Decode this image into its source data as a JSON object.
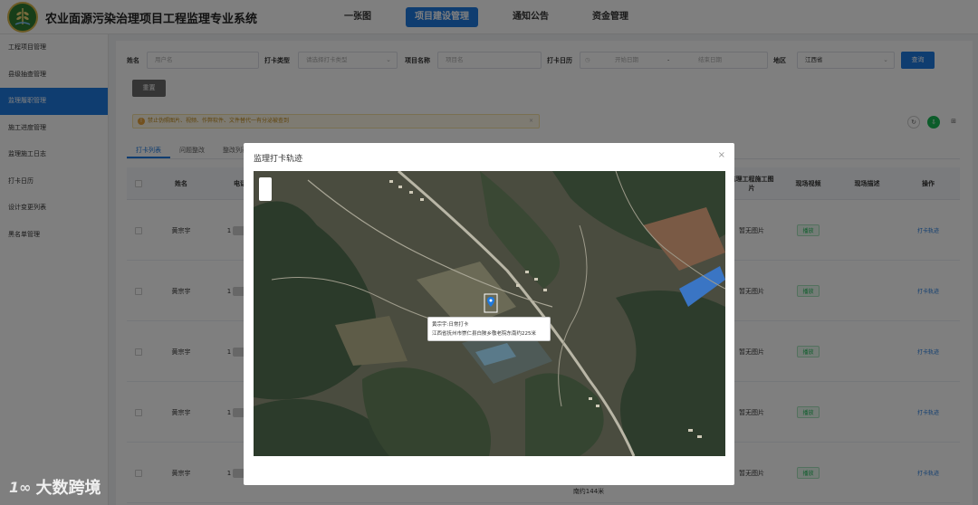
{
  "app": {
    "title": "农业面源污染治理项目工程监理专业系统"
  },
  "topnav": [
    {
      "label": "一张图",
      "active": false
    },
    {
      "label": "项目建设管理",
      "active": true
    },
    {
      "label": "通知公告",
      "active": false
    },
    {
      "label": "资金管理",
      "active": false
    }
  ],
  "sidebar": [
    {
      "label": "工程项目管理",
      "active": false
    },
    {
      "label": "县级抽查管理",
      "active": false
    },
    {
      "label": "监理履职管理",
      "active": true
    },
    {
      "label": "施工进度管理",
      "active": false
    },
    {
      "label": "监理施工日志",
      "active": false
    },
    {
      "label": "打卡日历",
      "active": false
    },
    {
      "label": "设计变更列表",
      "active": false
    },
    {
      "label": "黑名单管理",
      "active": false
    }
  ],
  "filters": {
    "name_label": "姓名",
    "name_placeholder": "用户名",
    "checkin_type_label": "打卡类型",
    "checkin_type_placeholder": "请选择打卡类型",
    "project_label": "项目名称",
    "project_placeholder": "项目名",
    "calendar_label": "打卡日历",
    "start_placeholder": "开始日期",
    "date_sep": "-",
    "end_placeholder": "结束日期",
    "region_label": "地区",
    "region_value": "江西省",
    "search_button": "查询",
    "reset_button": "重置"
  },
  "notice": {
    "text": "禁止伪照图片、视频、作弊软件、文件替代一有分泌被查到"
  },
  "tabs": [
    "打卡列表",
    "问题整改",
    "整改列表"
  ],
  "table": {
    "headers": {
      "name": "姓名",
      "phone": "电话",
      "engineering_image": "监理工程施工图片",
      "site_video": "现场视频",
      "site_desc": "现场描述",
      "action": "操作"
    },
    "rows": [
      {
        "name": "黄宗宇",
        "phone": "1",
        "image": "暂无图片",
        "video": "播放",
        "action": "打卡轨迹"
      },
      {
        "name": "黄宗宇",
        "phone": "1",
        "image": "暂无图片",
        "video": "播放",
        "action": "打卡轨迹"
      },
      {
        "name": "黄宗宇",
        "phone": "1",
        "image": "暂无图片",
        "video": "播放",
        "action": "打卡轨迹"
      },
      {
        "name": "黄宗宇",
        "phone": "1",
        "image": "暂无图片",
        "video": "播放",
        "action": "打卡轨迹"
      },
      {
        "name": "黄宗宇",
        "phone": "1",
        "image": "暂无图片",
        "video": "播放",
        "action": "打卡轨迹"
      }
    ],
    "partial_text": "南约144米"
  },
  "modal": {
    "title": "监理打卡轨迹",
    "close": "×",
    "popup_line1": "黄宗宇:日常打卡",
    "popup_line2": "江西省抚州市崇仁县白陂乡敬老院东南约225米"
  },
  "watermark": {
    "logo": "1∞",
    "text": "大数跨境"
  }
}
